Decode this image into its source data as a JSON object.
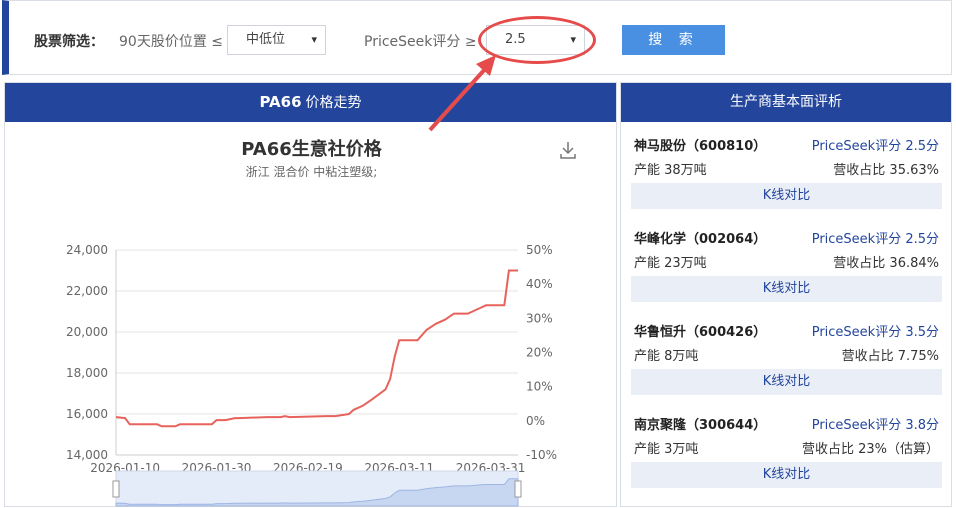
{
  "filter": {
    "title": "股票筛选：",
    "price_label": "90天股价位置 ≤",
    "price_select": "中低位",
    "score_label": "PriceSeek评分 ≥",
    "score_select": "2.5",
    "search_button": "搜 索"
  },
  "left_panel": {
    "head_product": "PA66",
    "head_text": "价格走势",
    "chart_title": "PA66生意社价格",
    "chart_subtitle": "浙江 混合价 中粘注塑级;"
  },
  "right_panel": {
    "head": "生产商基本面评析",
    "companies": [
      {
        "name": "神马股份（600810）",
        "score": "PriceSeek评分 2.5分",
        "capacity": "产能 38万吨",
        "revenue": "营收占比 35.63%",
        "kline": "K线对比"
      },
      {
        "name": "华峰化学（002064）",
        "score": "PriceSeek评分 2.5分",
        "capacity": "产能 23万吨",
        "revenue": "营收占比 36.84%",
        "kline": "K线对比"
      },
      {
        "name": "华鲁恒升（600426）",
        "score": "PriceSeek评分 3.5分",
        "capacity": "产能 8万吨",
        "revenue": "营收占比 7.75%",
        "kline": "K线对比"
      },
      {
        "name": "南京聚隆（300644）",
        "score": "PriceSeek评分 3.8分",
        "capacity": "产能 3万吨",
        "revenue": "营收占比 23%（估算）",
        "kline": "K线对比"
      }
    ]
  },
  "colors": {
    "brand": "#23469c",
    "button": "#4a90e2",
    "line": "#e8625c",
    "highlight": "#e64b4b"
  },
  "chart_data": {
    "type": "line",
    "title": "PA66生意社价格",
    "subtitle": "浙江 混合价 中粘注塑级;",
    "x_ticks": [
      "2026-01-10",
      "2026-01-30",
      "2026-02-19",
      "2026-03-11",
      "2026-03-31"
    ],
    "y_left_ticks": [
      "24,000",
      "22,000",
      "20,000",
      "18,000",
      "16,000",
      "14,000"
    ],
    "y_right_ticks": [
      "50%",
      "40%",
      "30%",
      "20%",
      "10%",
      "0%",
      "-10%"
    ],
    "ylim": [
      14000,
      24000
    ],
    "series": [
      {
        "x": [
          "2026-01-08",
          "2026-01-10",
          "2026-01-11",
          "2026-01-17",
          "2026-01-18",
          "2026-01-21",
          "2026-01-22",
          "2026-01-29",
          "2026-01-30",
          "2026-02-01",
          "2026-02-03",
          "2026-02-04",
          "2026-02-10",
          "2026-02-13",
          "2026-02-14",
          "2026-02-15",
          "2026-02-23",
          "2026-02-25",
          "2026-02-28",
          "2026-03-01",
          "2026-03-03",
          "2026-03-05",
          "2026-03-08",
          "2026-03-09",
          "2026-03-10",
          "2026-03-11",
          "2026-03-15",
          "2026-03-17",
          "2026-03-19",
          "2026-03-21",
          "2026-03-23",
          "2026-03-26",
          "2026-03-29",
          "2026-03-30",
          "2026-04-03",
          "2026-04-04",
          "2026-04-06"
        ],
        "values": [
          15850,
          15800,
          15500,
          15500,
          15400,
          15400,
          15500,
          15500,
          15700,
          15700,
          15800,
          15800,
          15850,
          15850,
          15900,
          15850,
          15900,
          15900,
          16000,
          16200,
          16400,
          16700,
          17200,
          17700,
          18800,
          19600,
          19600,
          20100,
          20400,
          20600,
          20900,
          20900,
          21200,
          21300,
          21300,
          23000,
          23000
        ]
      }
    ]
  }
}
